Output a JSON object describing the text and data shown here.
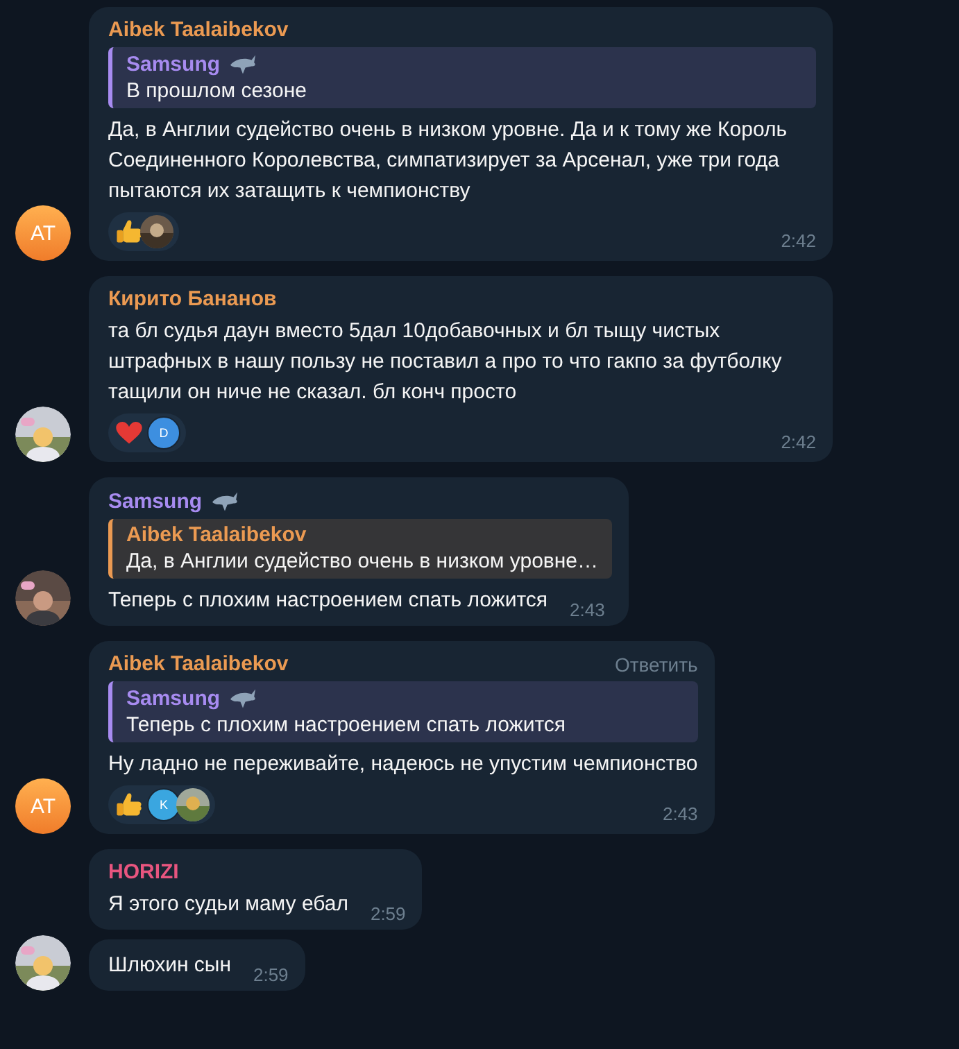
{
  "messages": [
    {
      "author": {
        "name": "Aibek Taalaibekov",
        "color": "#eb9a52",
        "badge": false
      },
      "reply": {
        "author": {
          "name": "Samsung",
          "color": "#a78bf0",
          "badge": true
        },
        "text": "В прошлом сезоне"
      },
      "text": "Да, в Англии судейство очень в низком уровне. Да и к тому же Король Соединенного Королевства, симпатизирует за Арсенал, уже три года пытаются их затащить к чемпионству",
      "reactions": [
        {
          "kind": "thumbs"
        },
        {
          "kind": "picture"
        }
      ],
      "time": "2:42",
      "avatar": {
        "kind": "initials",
        "text": "AT"
      }
    },
    {
      "author": {
        "name": "Кирито Бананов",
        "color": "#eb9a52",
        "badge": false
      },
      "text": "та бл судья даун вместо 5дал 10добавочных и бл тыщу чистых штрафных в нашу пользу не поставил а про то что гакпо за футболку тащили он ниче не сказал. бл конч просто",
      "reactions": [
        {
          "kind": "heart"
        },
        {
          "kind": "letter",
          "text": "D",
          "color": "#3d8fe0"
        }
      ],
      "time": "2:42",
      "avatar": {
        "kind": "picture"
      }
    },
    {
      "author": {
        "name": "Samsung",
        "color": "#a78bf0",
        "badge": true
      },
      "reply": {
        "author": {
          "name": "Aibek Taalaibekov",
          "color": "#eb9a52",
          "badge": false
        },
        "text": "Да, в Англии судейство очень в низком уровне…"
      },
      "text": "Теперь с плохим настроением спать ложится",
      "time": "2:43",
      "avatar": {
        "kind": "picture"
      }
    },
    {
      "author": {
        "name": "Aibek Taalaibekov",
        "color": "#eb9a52",
        "badge": false
      },
      "reply_action": "Ответить",
      "reply": {
        "author": {
          "name": "Samsung",
          "color": "#a78bf0",
          "badge": true
        },
        "text": "Теперь с плохим настроением спать ложится"
      },
      "text": "Ну ладно не переживайте, надеюсь не упустим чемпионство",
      "reactions": [
        {
          "kind": "thumbs"
        },
        {
          "kind": "letter",
          "text": "K",
          "color": "#3aa6e0"
        },
        {
          "kind": "picture"
        }
      ],
      "time": "2:43",
      "avatar": {
        "kind": "initials",
        "text": "AT"
      }
    },
    {
      "author": {
        "name": "HORIZI",
        "color": "#e8557f",
        "badge": false
      },
      "text": "Я этого судьи маму ебал",
      "time": "2:59"
    },
    {
      "text": "Шлюхин сын",
      "time": "2:59",
      "avatar": {
        "kind": "picture"
      }
    }
  ]
}
